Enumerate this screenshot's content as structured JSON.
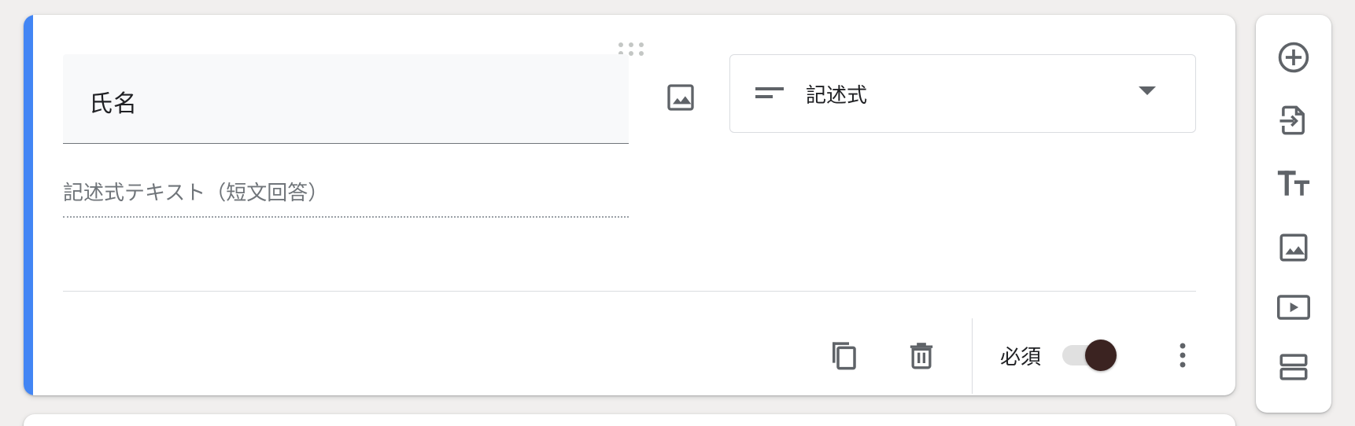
{
  "question": {
    "title": "氏名",
    "type_label": "記述式",
    "answer_placeholder": "記述式テキスト（短文回答）",
    "required_label": "必須",
    "required": true
  },
  "colors": {
    "accent": "#4285f4",
    "icon": "#5f6368",
    "toggle_knob": "#3b2321"
  },
  "icons": {
    "drag": "drag-handle-icon",
    "image": "image-icon",
    "short_answer": "short-answer-icon",
    "dropdown": "chevron-down-icon",
    "copy": "copy-icon",
    "delete": "trash-icon",
    "more": "more-vert-icon"
  },
  "toolbar": {
    "items": [
      "add-question-icon",
      "import-questions-icon",
      "title-text-icon",
      "image-icon",
      "video-icon",
      "section-icon"
    ]
  }
}
